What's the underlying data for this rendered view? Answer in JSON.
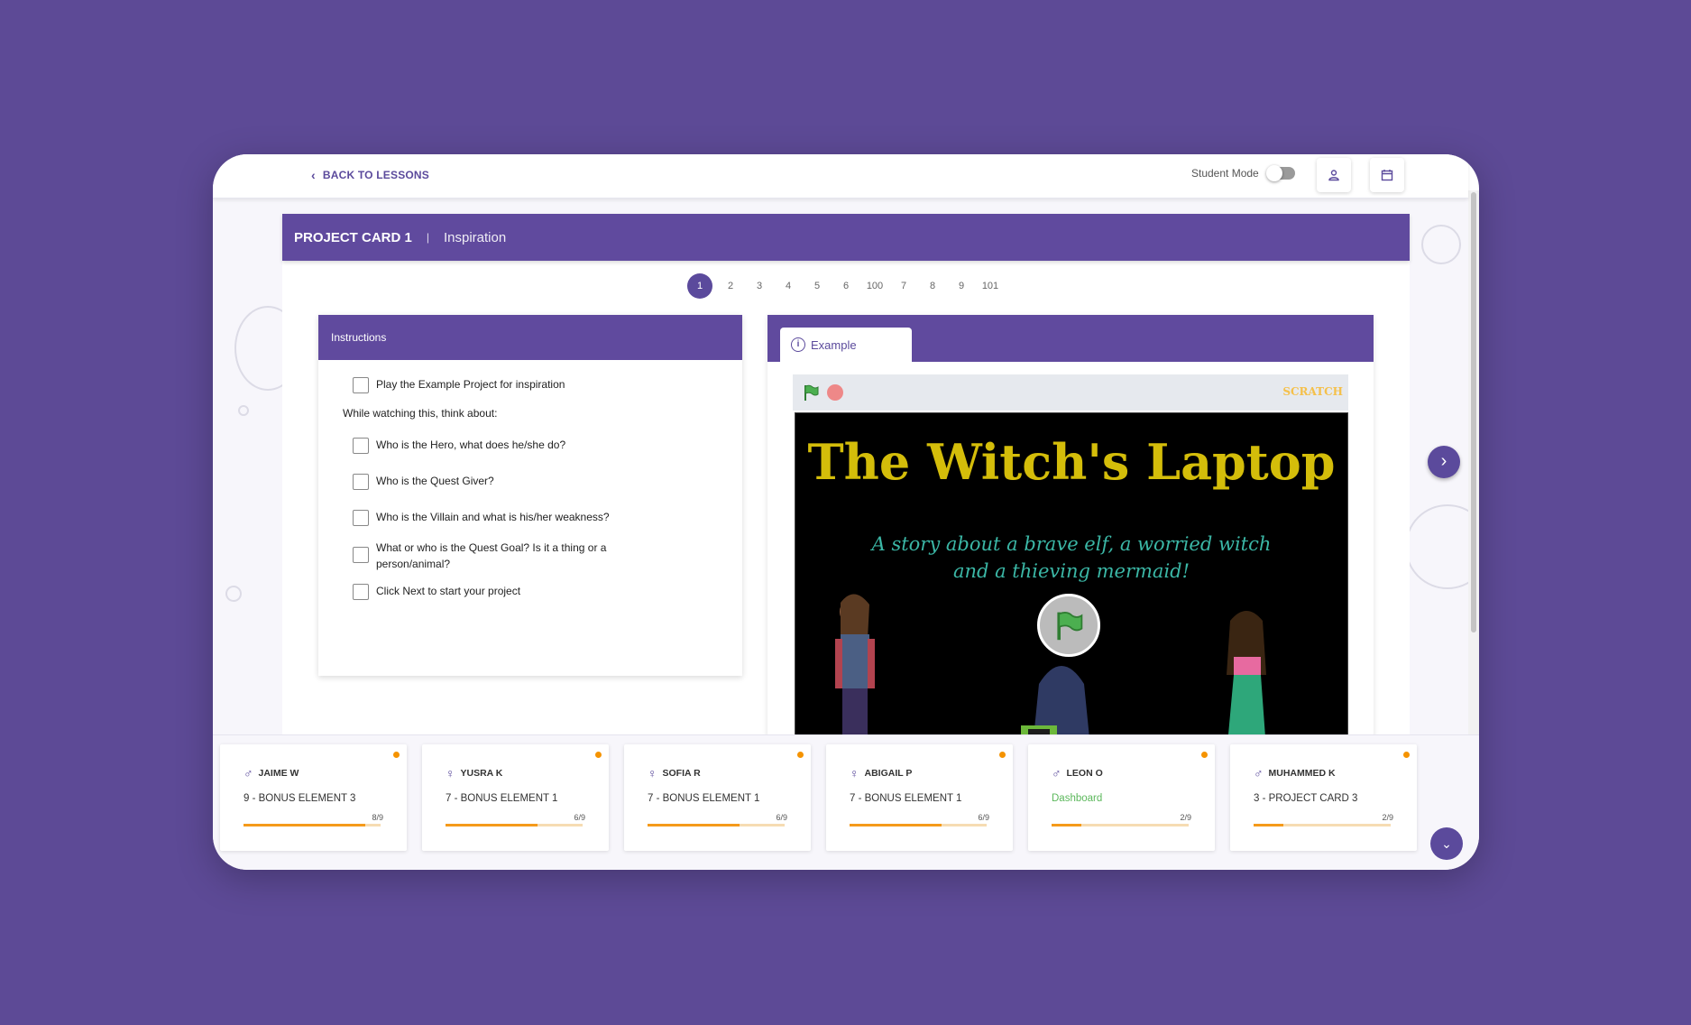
{
  "topbar": {
    "back_label": "BACK TO LESSONS",
    "student_mode_label": "Student Mode",
    "student_mode_on": false
  },
  "header": {
    "title": "PROJECT CARD 1",
    "separator": "|",
    "subtitle": "Inspiration"
  },
  "pager": {
    "pages": [
      "1",
      "2",
      "3",
      "4",
      "5",
      "6",
      "100",
      "7",
      "8",
      "9",
      "101"
    ],
    "active": "1"
  },
  "instructions": {
    "header": "Instructions",
    "item_play": "Play the Example Project for inspiration",
    "note": "While watching this, think about:",
    "item_hero": "Who is the Hero, what does he/she do?",
    "item_quest_giver": "Who is the Quest Giver?",
    "item_villain": "Who is the Villain and what is his/her weakness?",
    "item_goal": "What or who is the Quest Goal? Is it a thing or a person/animal?",
    "item_next": "Click Next to start your project"
  },
  "example": {
    "tab_label": "Example",
    "logo_text": "SCRATCH",
    "stage_title": "The Witch's Laptop",
    "stage_subtitle_1": "A story about a brave elf, a worried witch",
    "stage_subtitle_2": "and a thieving mermaid!"
  },
  "students": [
    {
      "gender": "♂",
      "name": "JAIME W",
      "task": "9 - BONUS ELEMENT 3",
      "progress_text": "8/9",
      "progress": 0.89
    },
    {
      "gender": "♀",
      "name": "YUSRA K",
      "task": "7 - BONUS ELEMENT 1",
      "progress_text": "6/9",
      "progress": 0.67
    },
    {
      "gender": "♀",
      "name": "SOFIA R",
      "task": "7 - BONUS ELEMENT 1",
      "progress_text": "6/9",
      "progress": 0.67
    },
    {
      "gender": "♀",
      "name": "ABIGAIL P",
      "task": "7 - BONUS ELEMENT 1",
      "progress_text": "6/9",
      "progress": 0.67
    },
    {
      "gender": "♂",
      "name": "LEON O",
      "task": "Dashboard",
      "progress_text": "2/9",
      "progress": 0.22
    },
    {
      "gender": "♂",
      "name": "MUHAMMED K",
      "task": "3 - PROJECT CARD 3",
      "progress_text": "2/9",
      "progress": 0.22
    }
  ],
  "colors": {
    "brand": "#5d4a96",
    "header": "#604a9e",
    "progress": "#f59a1b",
    "status_dot": "#f59300",
    "link": "#5cb85c"
  }
}
